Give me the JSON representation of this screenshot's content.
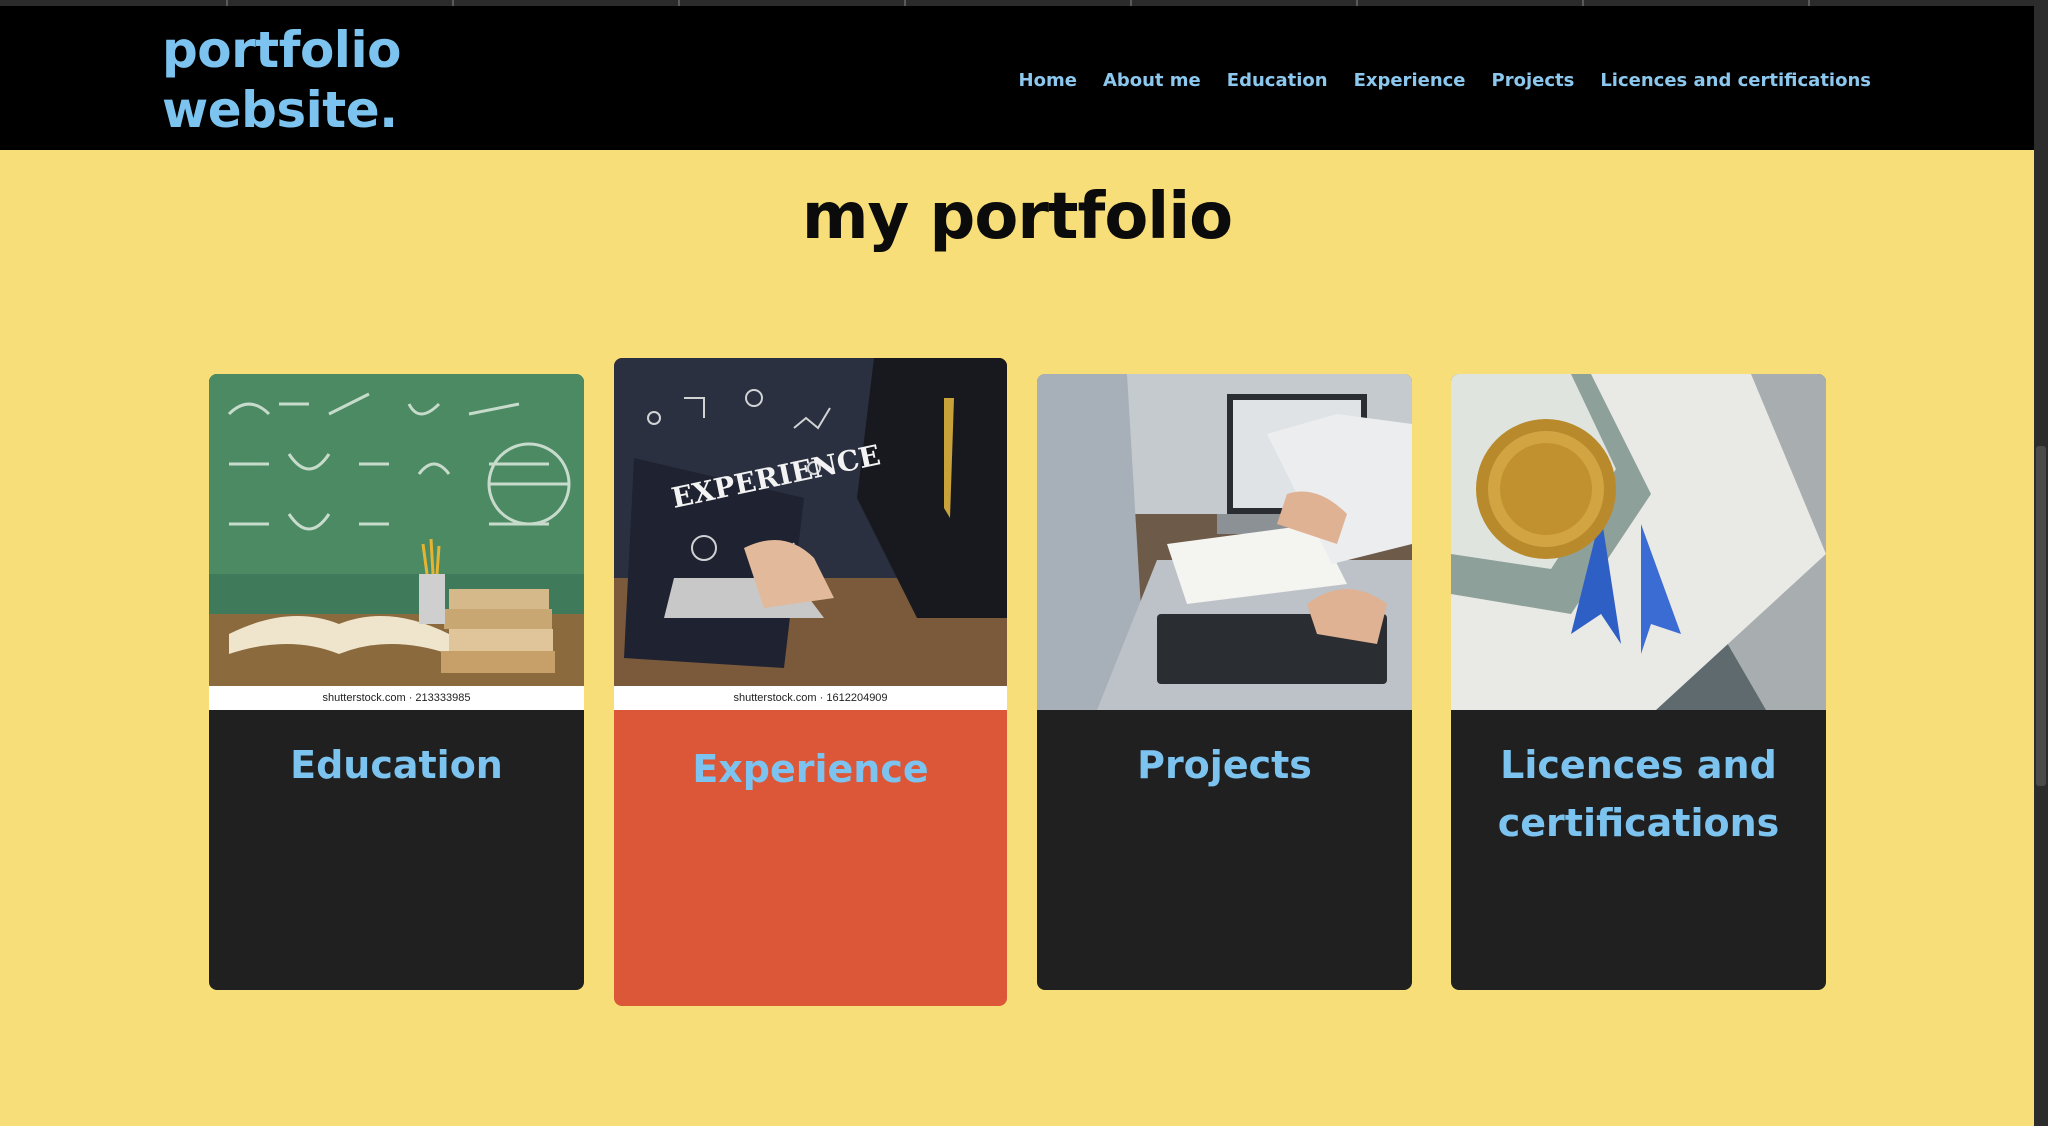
{
  "brand": {
    "line1": "portfolio",
    "line2": "website."
  },
  "nav": [
    "Home",
    "About me",
    "Education",
    "Experience",
    "Projects",
    "Licences and certifications"
  ],
  "heading": "my portfolio",
  "cards": [
    {
      "title": "Education",
      "credit": "shutterstock.com · 213333985",
      "icon": "education-image"
    },
    {
      "title": "Experience",
      "credit": "shutterstock.com · 1612204909",
      "icon": "experience-image"
    },
    {
      "title": "Projects",
      "icon": "projects-image"
    },
    {
      "title_line1": "Licences and",
      "title_line2": "certifications",
      "icon": "certificate-image"
    }
  ],
  "colors": {
    "background": "#f7de78",
    "navbar": "#000000",
    "accent": "#7cc4ef",
    "card": "#202020",
    "card_active": "#dc5638"
  }
}
